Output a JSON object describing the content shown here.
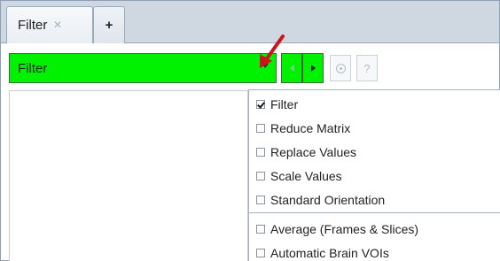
{
  "tabs": {
    "items": [
      {
        "label": "Filter",
        "close_glyph": "×"
      }
    ],
    "add_glyph": "+"
  },
  "toolbar": {
    "combo_value": "Filter",
    "help_glyph": "?"
  },
  "menu": {
    "group1": [
      {
        "label": "Filter",
        "checked": true
      },
      {
        "label": "Reduce Matrix",
        "checked": false
      },
      {
        "label": "Replace Values",
        "checked": false
      },
      {
        "label": "Scale Values",
        "checked": false
      },
      {
        "label": "Standard Orientation",
        "checked": false
      }
    ],
    "group2": [
      {
        "label": "Average (Frames & Slices)",
        "checked": false
      },
      {
        "label": "Automatic Brain VOIs",
        "checked": false
      }
    ]
  },
  "colors": {
    "accent_green": "#00f200",
    "annotation_arrow": "#d0121b"
  }
}
